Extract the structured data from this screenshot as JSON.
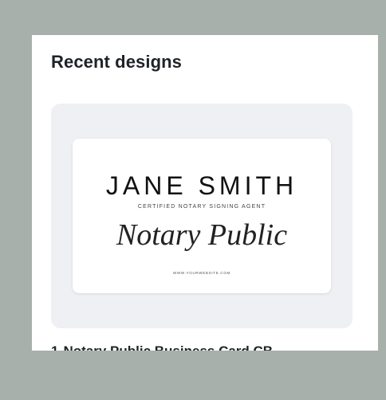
{
  "panel": {
    "title": "Recent designs"
  },
  "designs": [
    {
      "index": "1",
      "caption": "Notary Public Business Card CB...",
      "thumbnail": {
        "name": "JANE SMITH",
        "subtitle": "CERTIFIED NOTARY SIGNING AGENT",
        "script_text": "Notary Public",
        "website": "WWW.YOURWEBSITE.COM"
      }
    }
  ],
  "colors": {
    "background": "#a8b0ab",
    "panel": "#ffffff",
    "card": "#eef0f3",
    "text": "#1f2328"
  }
}
